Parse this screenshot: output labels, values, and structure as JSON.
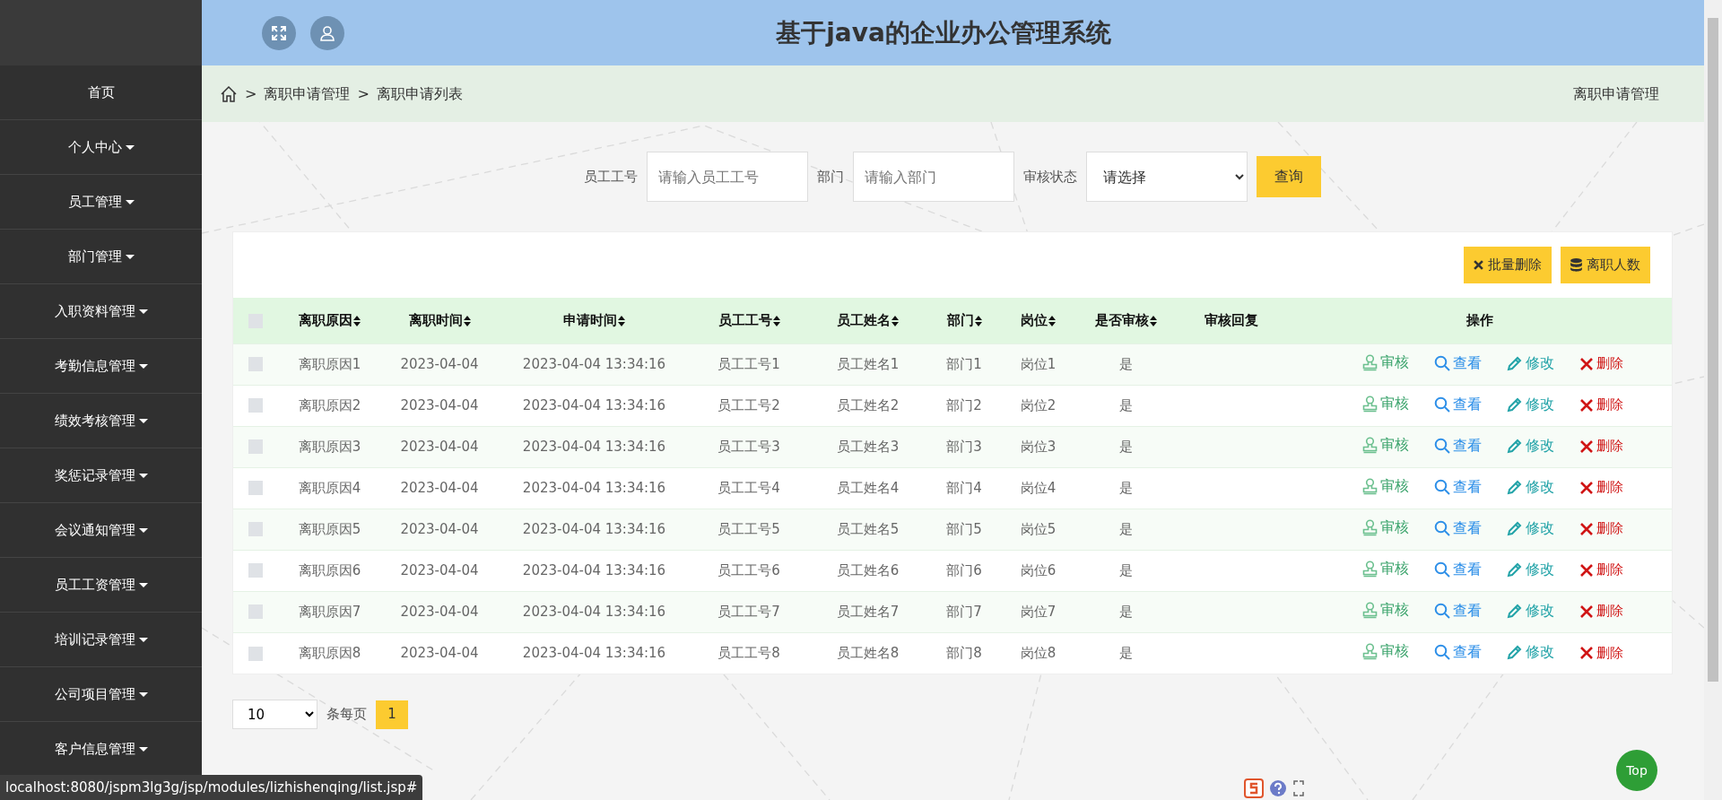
{
  "sidebar": {
    "items": [
      {
        "label": "首页",
        "has_submenu": false
      },
      {
        "label": "个人中心",
        "has_submenu": true
      },
      {
        "label": "员工管理",
        "has_submenu": true
      },
      {
        "label": "部门管理",
        "has_submenu": true
      },
      {
        "label": "入职资料管理",
        "has_submenu": true
      },
      {
        "label": "考勤信息管理",
        "has_submenu": true
      },
      {
        "label": "绩效考核管理",
        "has_submenu": true
      },
      {
        "label": "奖惩记录管理",
        "has_submenu": true
      },
      {
        "label": "会议通知管理",
        "has_submenu": true
      },
      {
        "label": "员工工资管理",
        "has_submenu": true
      },
      {
        "label": "培训记录管理",
        "has_submenu": true
      },
      {
        "label": "公司项目管理",
        "has_submenu": true
      },
      {
        "label": "客户信息管理",
        "has_submenu": true
      }
    ]
  },
  "header": {
    "title": "基于java的企业办公管理系统"
  },
  "breadcrumb": {
    "items": [
      {
        "separator": ">",
        "label": "离职申请管理"
      },
      {
        "separator": ">",
        "label": "离职申请列表"
      }
    ],
    "page_title": "离职申请管理"
  },
  "search": {
    "fields": [
      {
        "label": "员工工号",
        "placeholder": "请输入员工工号",
        "kind": "input"
      },
      {
        "label": "部门",
        "placeholder": "请输入部门",
        "kind": "input"
      },
      {
        "label": "审核状态",
        "value": "请选择",
        "kind": "select"
      }
    ],
    "button": "查询"
  },
  "toolbar": [
    {
      "label": "批量删除",
      "kind": "delete"
    },
    {
      "label": "离职人数",
      "kind": "stats"
    }
  ],
  "table": {
    "columns": [
      {
        "label": "离职原因",
        "sortable": true
      },
      {
        "label": "离职时间",
        "sortable": true
      },
      {
        "label": "申请时间",
        "sortable": true
      },
      {
        "label": "员工工号",
        "sortable": true
      },
      {
        "label": "员工姓名",
        "sortable": true
      },
      {
        "label": "部门",
        "sortable": true
      },
      {
        "label": "岗位",
        "sortable": true
      },
      {
        "label": "是否审核",
        "sortable": true
      },
      {
        "label": "审核回复",
        "sortable": false
      },
      {
        "label": "操作",
        "sortable": false
      }
    ],
    "select_all_checked": false,
    "rows": [
      {
        "cells": [
          "离职原因1",
          "2023-04-04",
          "2023-04-04 13:34:16",
          "员工工号1",
          "员工姓名1",
          "部门1",
          "岗位1",
          "是"
        ],
        "checked": false,
        "actions": [
          {
            "label": "审核",
            "kind": "audit"
          },
          {
            "label": "查看",
            "kind": "view"
          },
          {
            "label": "修改",
            "kind": "edit"
          },
          {
            "label": "删除",
            "kind": "delete"
          }
        ]
      },
      {
        "cells": [
          "离职原因2",
          "2023-04-04",
          "2023-04-04 13:34:16",
          "员工工号2",
          "员工姓名2",
          "部门2",
          "岗位2",
          "是"
        ],
        "checked": false,
        "actions": [
          {
            "label": "审核",
            "kind": "audit"
          },
          {
            "label": "查看",
            "kind": "view"
          },
          {
            "label": "修改",
            "kind": "edit"
          },
          {
            "label": "删除",
            "kind": "delete"
          }
        ]
      },
      {
        "cells": [
          "离职原因3",
          "2023-04-04",
          "2023-04-04 13:34:16",
          "员工工号3",
          "员工姓名3",
          "部门3",
          "岗位3",
          "是"
        ],
        "checked": false,
        "actions": [
          {
            "label": "审核",
            "kind": "audit"
          },
          {
            "label": "查看",
            "kind": "view"
          },
          {
            "label": "修改",
            "kind": "edit"
          },
          {
            "label": "删除",
            "kind": "delete"
          }
        ]
      },
      {
        "cells": [
          "离职原因4",
          "2023-04-04",
          "2023-04-04 13:34:16",
          "员工工号4",
          "员工姓名4",
          "部门4",
          "岗位4",
          "是"
        ],
        "checked": false,
        "actions": [
          {
            "label": "审核",
            "kind": "audit"
          },
          {
            "label": "查看",
            "kind": "view"
          },
          {
            "label": "修改",
            "kind": "edit"
          },
          {
            "label": "删除",
            "kind": "delete"
          }
        ]
      },
      {
        "cells": [
          "离职原因5",
          "2023-04-04",
          "2023-04-04 13:34:16",
          "员工工号5",
          "员工姓名5",
          "部门5",
          "岗位5",
          "是"
        ],
        "checked": false,
        "actions": [
          {
            "label": "审核",
            "kind": "audit"
          },
          {
            "label": "查看",
            "kind": "view"
          },
          {
            "label": "修改",
            "kind": "edit"
          },
          {
            "label": "删除",
            "kind": "delete"
          }
        ]
      },
      {
        "cells": [
          "离职原因6",
          "2023-04-04",
          "2023-04-04 13:34:16",
          "员工工号6",
          "员工姓名6",
          "部门6",
          "岗位6",
          "是"
        ],
        "checked": false,
        "actions": [
          {
            "label": "审核",
            "kind": "audit"
          },
          {
            "label": "查看",
            "kind": "view"
          },
          {
            "label": "修改",
            "kind": "edit"
          },
          {
            "label": "删除",
            "kind": "delete"
          }
        ]
      },
      {
        "cells": [
          "离职原因7",
          "2023-04-04",
          "2023-04-04 13:34:16",
          "员工工号7",
          "员工姓名7",
          "部门7",
          "岗位7",
          "是"
        ],
        "checked": false,
        "actions": [
          {
            "label": "审核",
            "kind": "audit"
          },
          {
            "label": "查看",
            "kind": "view"
          },
          {
            "label": "修改",
            "kind": "edit"
          },
          {
            "label": "删除",
            "kind": "delete"
          }
        ]
      },
      {
        "cells": [
          "离职原因8",
          "2023-04-04",
          "2023-04-04 13:34:16",
          "员工工号8",
          "员工姓名8",
          "部门8",
          "岗位8",
          "是"
        ],
        "checked": false,
        "actions": [
          {
            "label": "审核",
            "kind": "audit"
          },
          {
            "label": "查看",
            "kind": "view"
          },
          {
            "label": "修改",
            "kind": "edit"
          },
          {
            "label": "删除",
            "kind": "delete"
          }
        ]
      }
    ]
  },
  "pagination": {
    "page_size": "10",
    "page_size_label": "条每页",
    "pages": [
      {
        "label": "1",
        "selected": true
      }
    ]
  },
  "top_button": "Top",
  "status_bar": "localhost:8080/jspm3lg3g/jsp/modules/lizhishenqing/list.jsp#"
}
